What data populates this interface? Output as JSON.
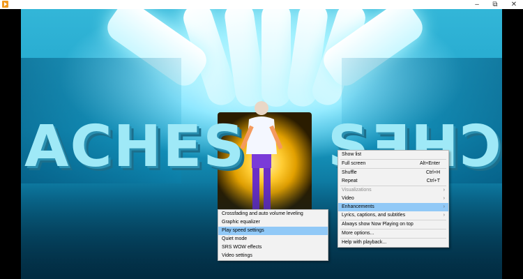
{
  "window": {
    "minimize_glyph": "–",
    "maximize_glyph": "⧉",
    "close_glyph": "✕"
  },
  "video": {
    "left_text": "ACHES",
    "right_text": "SƎHƆA"
  },
  "context_menu": {
    "items": [
      {
        "label": "Show list",
        "shortcut": "",
        "submenu": false,
        "disabled": false
      },
      {
        "label": "Full screen",
        "shortcut": "Alt+Enter",
        "submenu": false,
        "disabled": false
      },
      {
        "label": "Shuffle",
        "shortcut": "Ctrl+H",
        "submenu": false,
        "disabled": false
      },
      {
        "label": "Repeat",
        "shortcut": "Ctrl+T",
        "submenu": false,
        "disabled": false
      },
      {
        "label": "Visualizations",
        "shortcut": "",
        "submenu": true,
        "disabled": true
      },
      {
        "label": "Video",
        "shortcut": "",
        "submenu": true,
        "disabled": false
      },
      {
        "label": "Enhancements",
        "shortcut": "",
        "submenu": true,
        "disabled": false,
        "highlighted": true
      },
      {
        "label": "Lyrics, captions, and subtitles",
        "shortcut": "",
        "submenu": true,
        "disabled": false
      },
      {
        "label": "Always show Now Playing on top",
        "shortcut": "",
        "submenu": false,
        "disabled": false
      },
      {
        "label": "More options...",
        "shortcut": "",
        "submenu": false,
        "disabled": false
      },
      {
        "label": "Help with playback...",
        "shortcut": "",
        "submenu": false,
        "disabled": false
      }
    ],
    "submenu_arrow": "›"
  },
  "enhancements_submenu": {
    "items": [
      {
        "label": "Crossfading and auto volume leveling"
      },
      {
        "label": "Graphic equalizer"
      },
      {
        "label": "Play speed settings",
        "highlighted": true
      },
      {
        "label": "Quiet mode"
      },
      {
        "label": "SRS WOW effects"
      },
      {
        "label": "Video settings"
      }
    ]
  },
  "colors": {
    "highlight": "#91c9f7",
    "menu_bg": "#f2f2f2",
    "disabled_text": "#8d8d8d"
  }
}
